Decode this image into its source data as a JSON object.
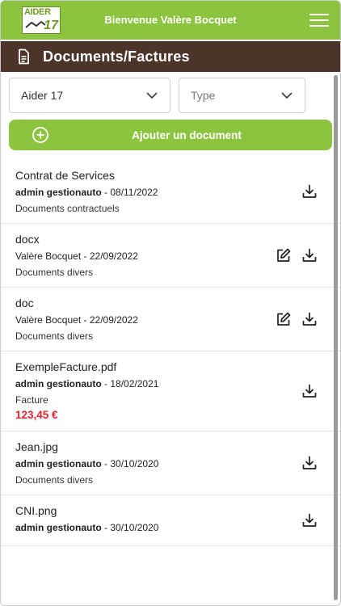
{
  "header": {
    "logo_text": "AIDER",
    "logo_number": "17",
    "welcome": "Bienvenue Valère Bocquet",
    "menu_icon": "hamburger-icon"
  },
  "section": {
    "title": "Documents/Factures",
    "icon": "document-icon"
  },
  "filters": {
    "company": "Aider 17",
    "type_placeholder": "Type"
  },
  "add_button": {
    "label": "Ajouter un document",
    "icon": "plus-circle-icon"
  },
  "documents": [
    {
      "name": "Contrat de Services",
      "author": "admin gestionauto",
      "date": "08/11/2022",
      "category": "Documents contractuels",
      "price": "",
      "editable": false
    },
    {
      "name": "docx",
      "author": "Valère Bocquet",
      "date": "22/09/2022",
      "category": "Documents divers",
      "price": "",
      "editable": true
    },
    {
      "name": "doc",
      "author": "Valère Bocquet",
      "date": "22/09/2022",
      "category": "Documents divers",
      "price": "",
      "editable": true
    },
    {
      "name": "ExempleFacture.pdf",
      "author": "admin gestionauto",
      "date": "18/02/2021",
      "category": "Facture",
      "price": "123,45 €",
      "editable": false
    },
    {
      "name": "Jean.jpg",
      "author": "admin gestionauto",
      "date": "30/10/2020",
      "category": "Documents divers",
      "price": "",
      "editable": false
    },
    {
      "name": "CNI.png",
      "author": "admin gestionauto",
      "date": "30/10/2020",
      "category": "",
      "price": "",
      "editable": false
    }
  ],
  "colors": {
    "green": "#8cc43f",
    "brown": "#4d342b",
    "price_red": "#e0242f"
  }
}
